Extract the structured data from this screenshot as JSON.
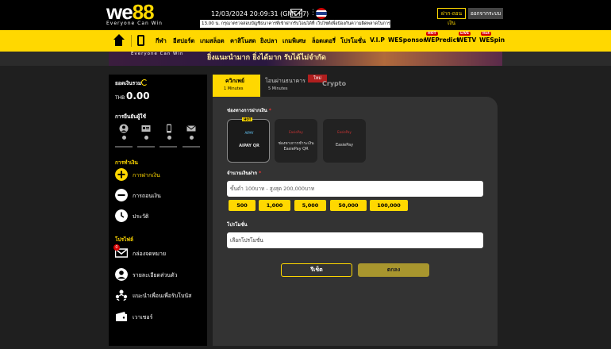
{
  "header": {
    "brand_we": "we",
    "brand_88": "88",
    "tagline": "Everyone Can Win",
    "datetime": "12/03/2024 20:09:31 (GMT+7)",
    "marquee": "13.00 น. กรุณาตรวจสอบบัญชีธนาคารที่เข้าฝากรับโอนได้ที่ เว็บไซต์เพื่อป้องกันความผิดพลาดในการทำ",
    "deposit_label": "ฝาก-ถอนเงิน",
    "logout_label": "ออกจากระบบ"
  },
  "nav": {
    "items": [
      {
        "label": "กีฬา"
      },
      {
        "label": "อีสปอร์ต"
      },
      {
        "label": "เกมสล็อต"
      },
      {
        "label": "คาสิโนสด"
      },
      {
        "label": "ยิงปลา"
      },
      {
        "label": "เกมพิเศษ"
      },
      {
        "label": "ล็อตเตอรี่"
      },
      {
        "label": "โปรโมชั่น"
      },
      {
        "label": "V.I.P"
      },
      {
        "label": "WESponsor"
      },
      {
        "label": "WEPredict",
        "badge": "HOT"
      },
      {
        "label": "WETV",
        "badge": "LIVE"
      },
      {
        "label": "WESpin",
        "badge": "Hot"
      }
    ]
  },
  "banner": {
    "tagline": "Everyone Can Win",
    "text": "ยิ่งแนะนำมาก ยิ่งได้มาก รับได้ไม่จำกัด"
  },
  "sidebar": {
    "balance_label": "ยอดเงินรวม",
    "currency": "THB",
    "balance": "0.00",
    "verify_label": "การยืนยันผู้ใช้",
    "transactions_label": "การทำเงิน",
    "transactions": [
      {
        "label": "การฝากเงิน",
        "active": true
      },
      {
        "label": "การถอนเงิน",
        "active": false
      },
      {
        "label": "ประวัติ",
        "active": false
      }
    ],
    "profile_label": "โปรไฟล์",
    "profile": [
      {
        "label": "กล่องจดหมาย",
        "badge": "0"
      },
      {
        "label": "รายละเอียดส่วนตัว"
      },
      {
        "label": "แนะนำเพื่อนเพื่อรับโบนัส"
      },
      {
        "label": "เวาเชอร์"
      }
    ]
  },
  "tabs": [
    {
      "label": "ควิกเพย์",
      "sub": "1 Minutes"
    },
    {
      "label": "โอนผ่านธนาคาร",
      "sub": "5 Minutes"
    },
    {
      "label": "Crypto"
    }
  ],
  "tab_new_badge": "ใหม่",
  "form": {
    "channel_label": "ช่องทางการฝากเงิน",
    "required_mark": "*",
    "methods": [
      {
        "name": "AIPAY QR",
        "badge": "HOT",
        "logo": "AIPAY"
      },
      {
        "name": "ช่องทางการชำระเงิน EasiePay QR",
        "logo": "EasiePay"
      },
      {
        "name": "EasiePay",
        "logo": "EasiePay"
      }
    ],
    "amount_label": "จำนวนเงินฝาก",
    "amount_placeholder": "ขั้นต่ำ 100บาท - สูงสุด 200,000บาท",
    "chips": [
      "500",
      "1,000",
      "5,000",
      "50,000",
      "100,000"
    ],
    "promo_label": "โปรโมชั่น",
    "promo_value": "เลือกโปรโมชั่น",
    "check_label": "รีเช็ต",
    "submit_label": "ตกลง"
  },
  "colors": {
    "accent": "#ffd800",
    "dark": "#000000",
    "panel": "#333333"
  }
}
